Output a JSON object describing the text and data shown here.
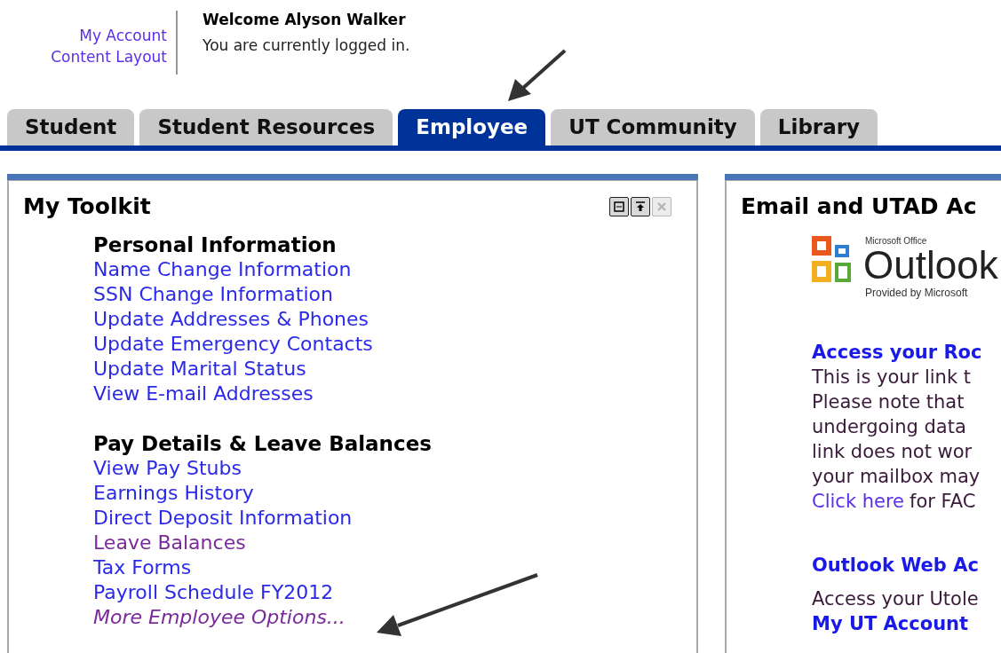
{
  "header": {
    "links": [
      {
        "label": "My Account"
      },
      {
        "label": "Content Layout"
      }
    ],
    "welcome": "Welcome Alyson Walker",
    "status": "You are currently logged in."
  },
  "tabs": [
    {
      "label": "Student",
      "selected": false
    },
    {
      "label": "Student Resources",
      "selected": false
    },
    {
      "label": "Employee",
      "selected": true
    },
    {
      "label": "UT Community",
      "selected": false
    },
    {
      "label": "Library",
      "selected": false
    }
  ],
  "toolkit": {
    "title": "My Toolkit",
    "controls": [
      {
        "kind": "restore",
        "disabled": false
      },
      {
        "kind": "top",
        "disabled": false
      },
      {
        "kind": "close",
        "disabled": true
      }
    ],
    "sections": [
      {
        "heading": "Personal Information",
        "links": [
          {
            "label": "Name Change Information",
            "visited": false,
            "italic": false
          },
          {
            "label": "SSN Change Information",
            "visited": false,
            "italic": false
          },
          {
            "label": "Update Addresses & Phones",
            "visited": false,
            "italic": false
          },
          {
            "label": "Update Emergency Contacts",
            "visited": false,
            "italic": false
          },
          {
            "label": "Update Marital Status",
            "visited": false,
            "italic": false
          },
          {
            "label": "View E-mail Addresses",
            "visited": false,
            "italic": false
          }
        ]
      },
      {
        "heading": "Pay Details & Leave Balances",
        "links": [
          {
            "label": "View Pay Stubs",
            "visited": false,
            "italic": false
          },
          {
            "label": "Earnings History",
            "visited": false,
            "italic": false
          },
          {
            "label": "Direct Deposit Information",
            "visited": false,
            "italic": false
          },
          {
            "label": "Leave Balances",
            "visited": true,
            "italic": false
          },
          {
            "label": "Tax Forms",
            "visited": false,
            "italic": false
          },
          {
            "label": "Payroll Schedule FY2012",
            "visited": false,
            "italic": false
          },
          {
            "label": "More Employee Options...",
            "visited": true,
            "italic": true
          }
        ]
      }
    ]
  },
  "email_panel": {
    "title": "Email and UTAD Ac",
    "logo": {
      "brand": "Microsoft Office",
      "product": "Outlook",
      "note": "Provided by Microsoft"
    },
    "rocket": {
      "heading": "Access your Roc",
      "lines": [
        "This is your link t",
        "Please note that",
        "undergoing data",
        "link does not wor",
        "your mailbox may"
      ],
      "link": "Click here",
      "link_rest": "for FAC"
    },
    "owa": {
      "heading": "Outlook Web Ac",
      "text": "Access your Utole"
    },
    "account": {
      "heading": "My UT Account"
    }
  }
}
